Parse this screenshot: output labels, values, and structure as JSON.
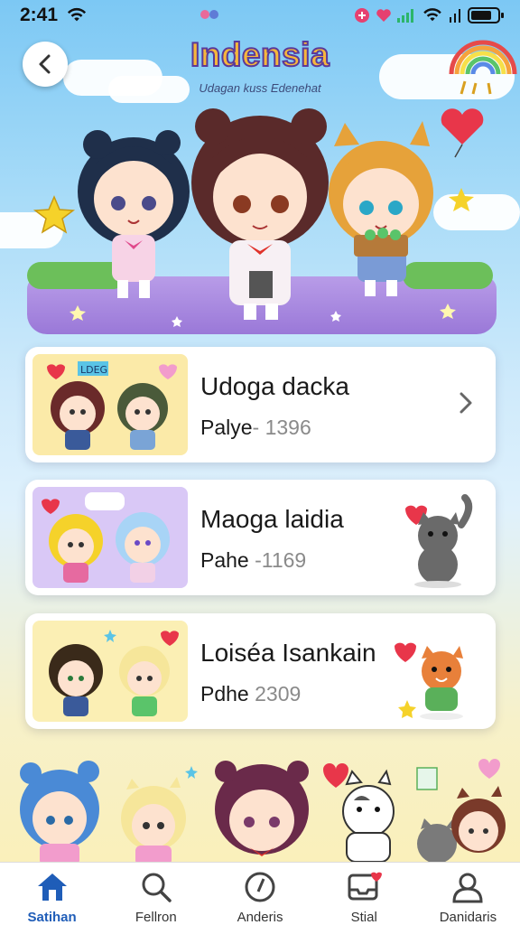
{
  "status": {
    "time": "2:41"
  },
  "header": {
    "title": "Indensia",
    "subtitle": "Udagan kuss Edenehat"
  },
  "cards": [
    {
      "title": "Udoga dacka",
      "meta_label": "Palye",
      "meta_value": "- 1396",
      "badge": "LDEG",
      "action": "chevron"
    },
    {
      "title": "Maoga laidia",
      "meta_label": "Pahe",
      "meta_value": " -1169",
      "badge": "",
      "action": "cat-gray"
    },
    {
      "title": "Loiséa Isankain",
      "meta_label": "Pdhe",
      "meta_value": " 2309",
      "badge": "",
      "action": "cat-orange"
    }
  ],
  "tabs": [
    {
      "label": "Satihan",
      "icon": "home-icon",
      "active": true
    },
    {
      "label": "Fellron",
      "icon": "search-icon",
      "active": false
    },
    {
      "label": "Anderis",
      "icon": "compass-icon",
      "active": false
    },
    {
      "label": "Stial",
      "icon": "inbox-icon",
      "active": false
    },
    {
      "label": "Danidaris",
      "icon": "profile-icon",
      "active": false
    }
  ],
  "colors": {
    "accent": "#1f5db8",
    "title_fill": "#f6b73c",
    "title_outline": "#5a3a9a",
    "heart": "#e8364a"
  }
}
